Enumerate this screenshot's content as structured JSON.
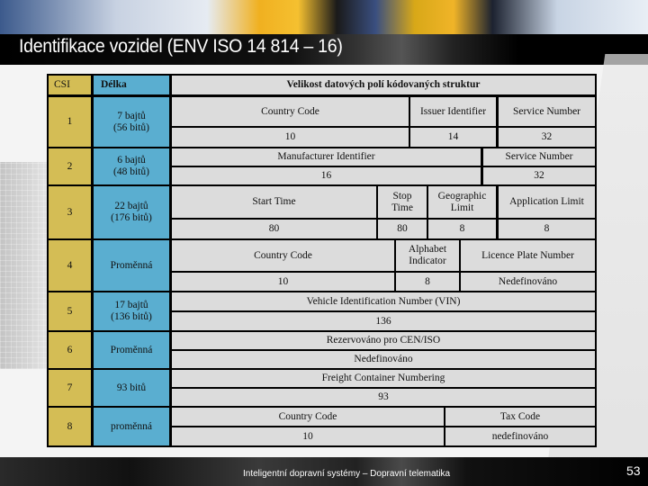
{
  "slide": {
    "title": "Identifikace vozidel (ENV ISO 14 814 – 16)",
    "footer": "Inteligentní dopravní systémy – Dopravní telematika",
    "page_number": "53"
  },
  "colors": {
    "csi_column": "#d4bd55",
    "length_column": "#5aaed0",
    "field_cells": "#dcdcdc",
    "borders": "#000000"
  },
  "table": {
    "headers": {
      "csi": "CSI",
      "length": "Délka",
      "fields": "Velikost datových polí kódovaných struktur"
    },
    "rows": [
      {
        "csi": "1",
        "length_line1": "7 bajtů",
        "length_line2": "(56 bitů)",
        "fields": [
          {
            "name": "Country Code",
            "bits": "10"
          },
          {
            "name": "Issuer Identifier",
            "bits": "14"
          },
          {
            "name": "Service Number",
            "bits": "32"
          }
        ]
      },
      {
        "csi": "2",
        "length_line1": "6 bajtů",
        "length_line2": "(48 bitů)",
        "fields": [
          {
            "name": "Manufacturer Identifier",
            "bits": "16"
          },
          {
            "name": "Service Number",
            "bits": "32"
          }
        ]
      },
      {
        "csi": "3",
        "length_line1": "22 bajtů",
        "length_line2": "(176 bitů)",
        "fields": [
          {
            "name": "Start Time",
            "bits": "80"
          },
          {
            "name_line1": "Stop",
            "name_line2": "Time",
            "bits": "80"
          },
          {
            "name_line1": "Geographic",
            "name_line2": "Limit",
            "bits": "8"
          },
          {
            "name": "Application Limit",
            "bits": "8"
          }
        ]
      },
      {
        "csi": "4",
        "length_line1": "Proměnná",
        "fields": [
          {
            "name": "Country Code",
            "bits": "10"
          },
          {
            "name_line1": "Alphabet",
            "name_line2": "Indicator",
            "bits": "8"
          },
          {
            "name": "Licence Plate Number",
            "bits": "Nedefinováno"
          }
        ]
      },
      {
        "csi": "5",
        "length_line1": "17 bajtů",
        "length_line2": "(136 bitů)",
        "fields": [
          {
            "name": "Vehicle Identification Number (VIN)",
            "bits": "136"
          }
        ]
      },
      {
        "csi": "6",
        "length_line1": "Proměnná",
        "fields": [
          {
            "name": "Rezervováno pro CEN/ISO",
            "bits": "Nedefinováno"
          }
        ]
      },
      {
        "csi": "7",
        "length_line1": "93 bitů",
        "fields": [
          {
            "name": "Freight Container Numbering",
            "bits": "93"
          }
        ]
      },
      {
        "csi": "8",
        "length_line1": "proměnná",
        "fields": [
          {
            "name": "Country Code",
            "bits": "10"
          },
          {
            "name": "Tax Code",
            "bits": "nedefinováno"
          }
        ]
      }
    ]
  }
}
